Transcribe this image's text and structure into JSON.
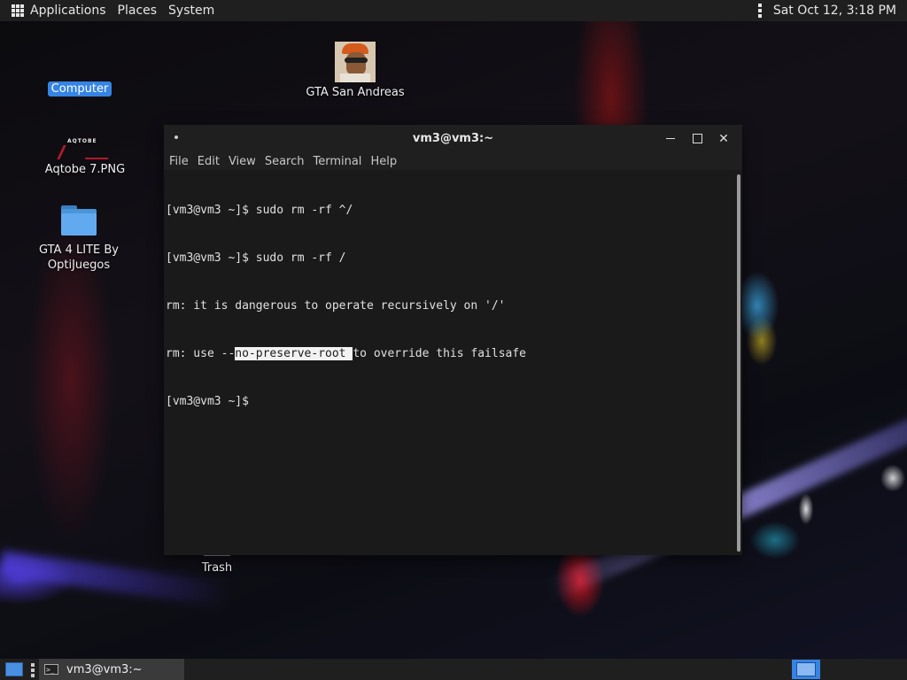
{
  "top_panel": {
    "menus": [
      "Applications",
      "Places",
      "System"
    ],
    "clock": "Sat Oct 12,  3:18 PM"
  },
  "desktop": {
    "icons": {
      "computer": "Computer",
      "gta_sa": "GTA San Andreas",
      "aqtobe": "Aqtobe 7.PNG",
      "aqtobe_thumb_text": "AQTOBE",
      "gta4_line1": "GTA 4 LITE By",
      "gta4_line2": "OptiJuegos",
      "trash": "Trash"
    }
  },
  "terminal": {
    "title": "vm3@vm3:~",
    "menu": [
      "File",
      "Edit",
      "View",
      "Search",
      "Terminal",
      "Help"
    ],
    "lines": {
      "l1": "[vm3@vm3 ~]$ sudo rm -rf ^/",
      "l2": "[vm3@vm3 ~]$ sudo rm -rf /",
      "l3": "rm: it is dangerous to operate recursively on '/'",
      "l4_pre": "rm: use --",
      "l4_sel": "no-preserve-root ",
      "l4_post": "to override this failsafe",
      "l5": "[vm3@vm3 ~]$"
    }
  },
  "bottom_panel": {
    "task_label": "vm3@vm3:~",
    "task_icon_text": ">_"
  },
  "colors": {
    "panel": "#1f1f1f",
    "selection_blue": "#3584e4",
    "terminal_bg": "#1a1a1a"
  }
}
